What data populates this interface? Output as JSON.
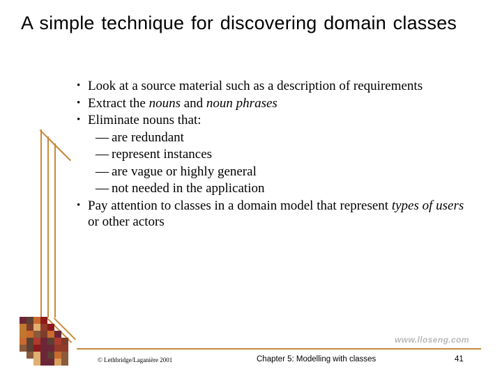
{
  "slide": {
    "title": "A simple technique for discovering domain classes",
    "bullets": [
      {
        "marker": "•",
        "segments": [
          {
            "text": "Look at a source material such as a description of requirements",
            "style": "normal"
          }
        ]
      },
      {
        "marker": "•",
        "segments": [
          {
            "text": "Extract the ",
            "style": "normal"
          },
          {
            "text": "nouns",
            "style": "italic"
          },
          {
            "text": " and ",
            "style": "normal"
          },
          {
            "text": "noun phrases",
            "style": "italic"
          }
        ]
      },
      {
        "marker": "•",
        "segments": [
          {
            "text": "Eliminate nouns that:",
            "style": "normal"
          }
        ]
      }
    ],
    "sub_items": [
      {
        "marker": "—",
        "text": "are redundant"
      },
      {
        "marker": "—",
        "text": "represent instances"
      },
      {
        "marker": "—",
        "text": "are vague or highly general"
      },
      {
        "marker": "—",
        "text": "not needed in the application"
      }
    ],
    "last_bullet": {
      "marker": "•",
      "segments": [
        {
          "text": "Pay attention to classes in a domain model that represent ",
          "style": "normal"
        },
        {
          "text": "types of users",
          "style": "italic"
        },
        {
          "text": " or other actors",
          "style": "normal"
        }
      ]
    }
  },
  "footer": {
    "copyright": "© Lethbridge/Laganière 2001",
    "chapter": "Chapter 5: Modelling with classes",
    "page_number": "41",
    "watermark": "www.lloseng.com"
  },
  "colors": {
    "accent": "#c8893c",
    "text": "#000000",
    "background": "#ffffff",
    "watermark": "#b8b8b8"
  },
  "mosaic": {
    "palette": [
      "#8c1a1a",
      "#b03a2e",
      "#c96b2e",
      "#d9a05b",
      "#7d3c2a",
      "#a0522d",
      "#5c4033",
      "#e0b070",
      "#6b2737",
      "#923b2a",
      "#c0772f",
      "#8a5a3b"
    ]
  }
}
